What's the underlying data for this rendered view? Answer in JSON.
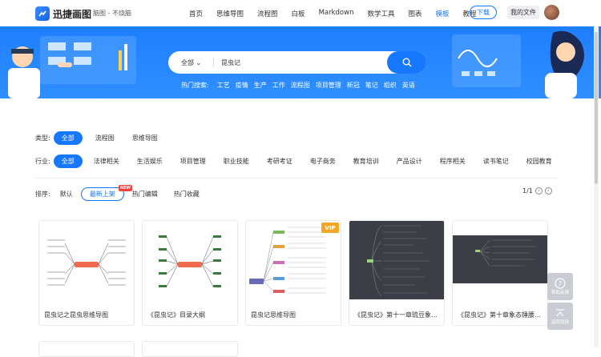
{
  "header": {
    "brand": "迅捷画图",
    "subtitle": "脑图 - 不烧脑",
    "nav": [
      "首页",
      "思维导图",
      "流程图",
      "白板",
      "Markdown",
      "数学工具",
      "图表",
      "模板",
      "教程"
    ],
    "active_nav": "模板",
    "download": "下载",
    "my_files": "我的文件"
  },
  "search": {
    "category": "全部",
    "query": "昆虫记",
    "hot_label": "热门搜索:",
    "hot": [
      "工艺",
      "疫情",
      "生产",
      "工作",
      "流程图",
      "项目管理",
      "新冠",
      "笔记",
      "组织",
      "英语"
    ]
  },
  "filters": {
    "type_label": "类型:",
    "types": [
      "全部",
      "流程图",
      "思维导图"
    ],
    "industry_label": "行业:",
    "industries": [
      "全部",
      "法律相关",
      "生活娱乐",
      "项目管理",
      "职业技能",
      "考研考证",
      "电子商务",
      "教育培训",
      "产品设计",
      "程序相关",
      "读书笔记",
      "校园教育"
    ],
    "sort_label": "排序:",
    "sorts": [
      "默认",
      "最新上架",
      "热门编辑",
      "热门收藏"
    ],
    "new_badge": "NEW",
    "page": "1/1"
  },
  "cards": [
    {
      "title": "昆虫记之昆虫思维导图",
      "vip": ""
    },
    {
      "title": "《昆虫记》目录大纲",
      "vip": ""
    },
    {
      "title": "昆虫记思维导图",
      "vip": "VIP"
    },
    {
      "title": "《昆虫记》第十一章琉豆象思...",
      "vip": ""
    },
    {
      "title": "《昆虫记》第十章象态锤腰象...",
      "vip": ""
    }
  ],
  "side": {
    "help": "帮助反馈",
    "top": "返回顶部"
  },
  "colors": {
    "accent": "#1677ff",
    "banner": "#1e7fff",
    "badge": "#f2443c",
    "vip": "#f5a623"
  }
}
